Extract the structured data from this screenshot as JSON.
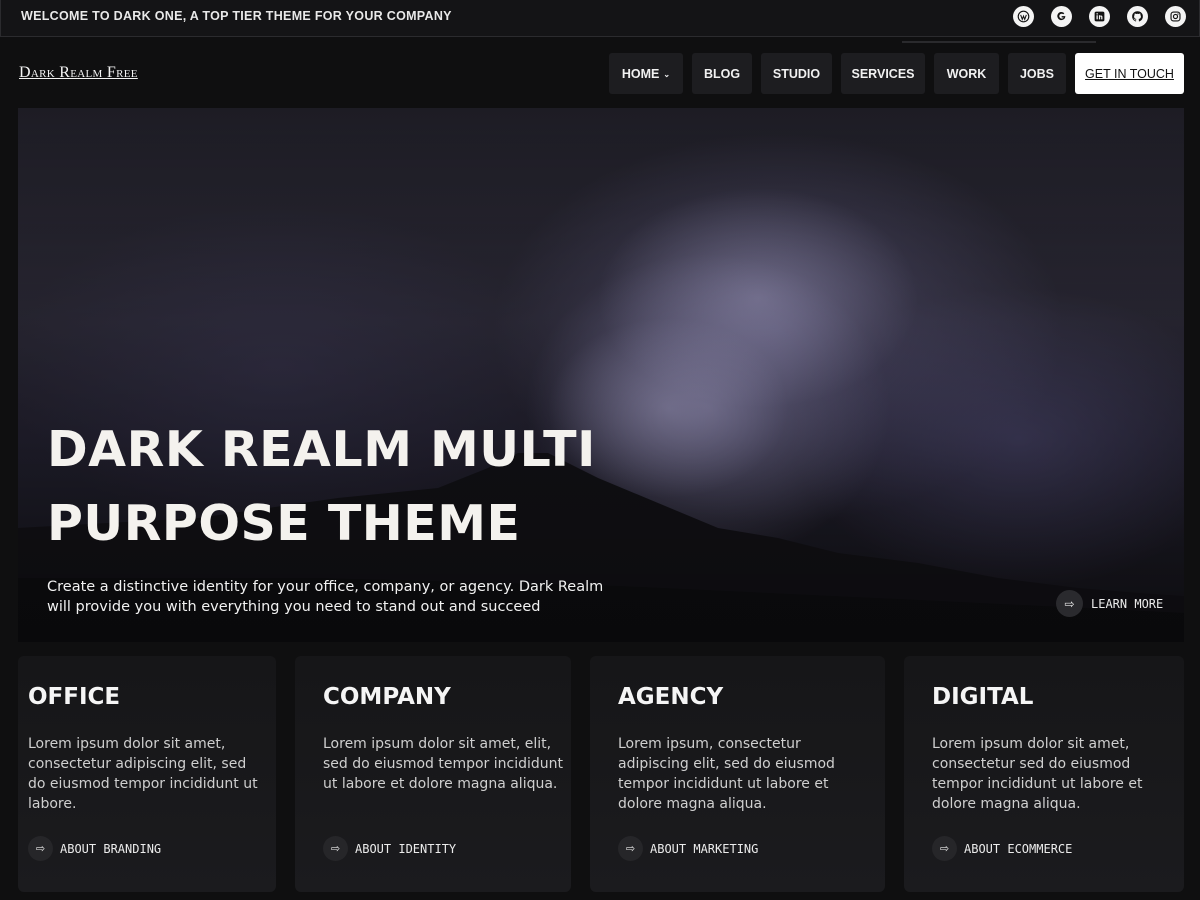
{
  "topbar": {
    "text": "WELCOME TO DARK ONE, A TOP TIER THEME FOR YOUR COMPANY",
    "social": [
      "wordpress-icon",
      "google-icon",
      "linkedin-icon",
      "github-icon",
      "instagram-icon"
    ]
  },
  "header": {
    "site_title": "Dark Realm Free",
    "nav": [
      {
        "label": "HOME",
        "has_dropdown": true
      },
      {
        "label": "BLOG"
      },
      {
        "label": "STUDIO"
      },
      {
        "label": "SERVICES"
      },
      {
        "label": "WORK"
      },
      {
        "label": "JOBS"
      }
    ],
    "cta": "GET IN TOUCH"
  },
  "hero": {
    "title_line1": "DARK REALM MULTI",
    "title_line2": "PURPOSE THEME",
    "subtitle": "Create a distinctive identity for your office, company, or agency. Dark Realm will provide you with everything you need to stand out and succeed",
    "learn_more": "LEARN MORE"
  },
  "cards": [
    {
      "title": "OFFICE",
      "text": "Lorem ipsum dolor sit amet, consectetur adipiscing elit, sed do eiusmod tempor incididunt ut labore.",
      "link": "ABOUT BRANDING"
    },
    {
      "title": "COMPANY",
      "text": "Lorem ipsum dolor sit amet, elit, sed do eiusmod tempor incididunt ut labore et dolore magna aliqua.",
      "link": "ABOUT IDENTITY"
    },
    {
      "title": "AGENCY",
      "text": "Lorem ipsum, consectetur adipiscing elit, sed do eiusmod tempor incididunt ut labore et dolore magna aliqua.",
      "link": "ABOUT MARKETING"
    },
    {
      "title": "DIGITAL",
      "text": "Lorem ipsum dolor sit amet, consectetur sed do eiusmod tempor incididunt ut labore et dolore magna aliqua.",
      "link": "ABOUT ECOMMERCE"
    }
  ],
  "colors": {
    "background": "#0f0f10",
    "nav_bg": "#1d1d20",
    "cta_bg": "#ffffff",
    "card_bg": "#1a1a1d",
    "text": "#f2f2f2"
  }
}
